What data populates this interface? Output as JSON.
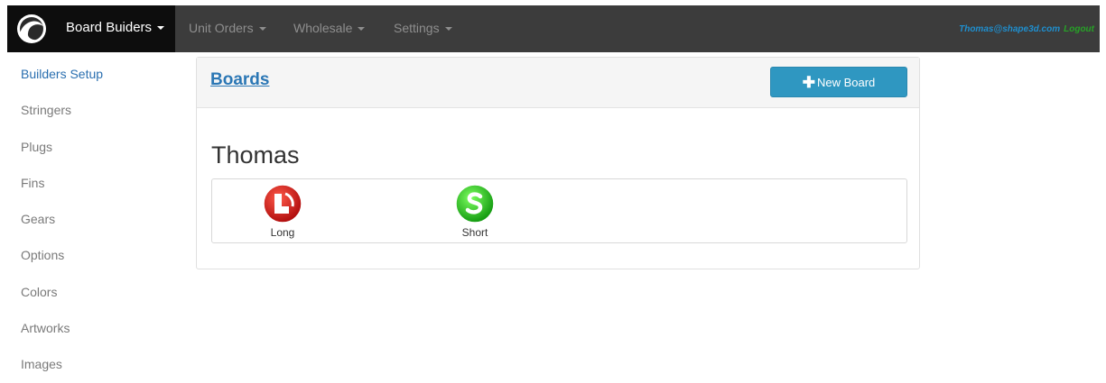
{
  "navbar": {
    "brand_label": "Board Buiders",
    "menus": [
      "Unit Orders",
      "Wholesale",
      "Settings"
    ],
    "user_email": "Thomas@shape3d.com",
    "logout_label": "Logout"
  },
  "sidebar": {
    "items": [
      "Builders Setup",
      "Stringers",
      "Plugs",
      "Fins",
      "Gears",
      "Options",
      "Colors",
      "Artworks",
      "Images"
    ],
    "active": "Builders Setup"
  },
  "panel": {
    "title": "Boards",
    "new_button_label": "New Board",
    "builder_name": "Thomas",
    "boards": [
      {
        "label": "Long",
        "color": "#d62020",
        "letter": "L"
      },
      {
        "label": "Short",
        "color": "#22b91a",
        "letter": "S"
      }
    ]
  },
  "colors": {
    "navbar_bg": "#3c3c3c",
    "brand_bg": "#0d0d0d",
    "primary_button": "#2f97c1",
    "link": "#2b77b5"
  }
}
